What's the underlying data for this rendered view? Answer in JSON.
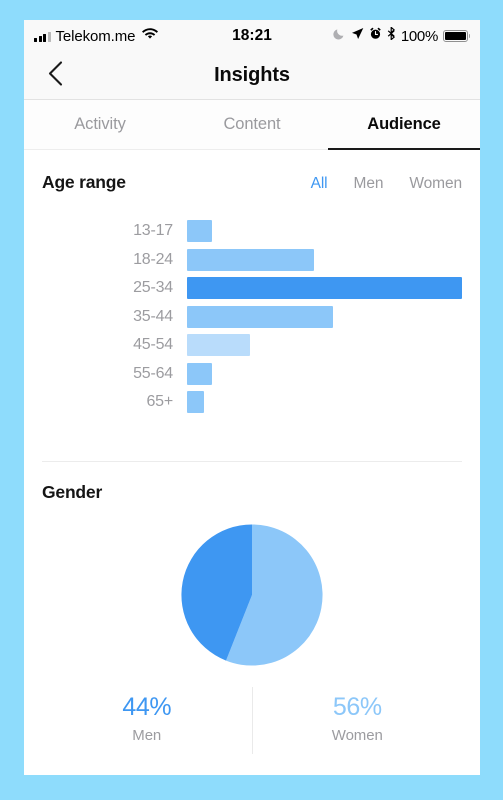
{
  "frame": {
    "bezel_color": "#8EDCFC",
    "screen_color": "#FFFFFF"
  },
  "status_bar": {
    "carrier": "Telekom.me",
    "time": "18:21",
    "battery_percent": "100%",
    "icons": [
      "signal-bars-icon",
      "wifi-icon",
      "moon-icon",
      "location-arrow-icon",
      "alarm-clock-icon",
      "bluetooth-icon",
      "battery-icon"
    ]
  },
  "nav": {
    "back_icon": "chevron-left-icon",
    "title": "Insights"
  },
  "tabs": [
    {
      "label": "Activity",
      "active": false
    },
    {
      "label": "Content",
      "active": false
    },
    {
      "label": "Audience",
      "active": true
    }
  ],
  "age_section": {
    "title": "Age range",
    "filters": [
      {
        "label": "All",
        "active": true
      },
      {
        "label": "Men",
        "active": false
      },
      {
        "label": "Women",
        "active": false
      }
    ]
  },
  "gender_section": {
    "title": "Gender"
  },
  "gender_stats": [
    {
      "percent": "44%",
      "label": "Men",
      "color": "#3E97F2"
    },
    {
      "percent": "56%",
      "label": "Women",
      "color": "#8CC7F9"
    }
  ],
  "colors": {
    "accent_blue": "#3E97F2",
    "light_blue": "#8CC7F9",
    "pale_blue": "#B9DCFB",
    "label_gray": "#9C9CA0",
    "text_black": "#0A0A0A"
  },
  "chart_data": [
    {
      "type": "bar",
      "title": "Age range",
      "orientation": "horizontal",
      "xlabel": "",
      "ylabel": "",
      "grid": false,
      "legend": false,
      "categories": [
        "13-17",
        "18-24",
        "25-34",
        "35-44",
        "45-54",
        "55-64",
        "65+"
      ],
      "values": [
        9,
        46,
        100,
        53,
        23,
        9,
        6
      ],
      "unit": "relative share (max = 100)",
      "bar_colors": [
        "#8CC7F9",
        "#8CC7F9",
        "#3E97F2",
        "#8CC7F9",
        "#B9DCFB",
        "#8CC7F9",
        "#8CC7F9"
      ],
      "xlim": [
        0,
        100
      ]
    },
    {
      "type": "pie",
      "title": "Gender",
      "legend": "below",
      "labels": [
        "Men",
        "Women"
      ],
      "values": [
        44,
        56
      ],
      "display_values": [
        "44%",
        "56%"
      ],
      "slice_colors": [
        "#3E97F2",
        "#8CC7F9"
      ],
      "start_angle_deg": 0,
      "direction": "counterclockwise-for-men"
    }
  ]
}
